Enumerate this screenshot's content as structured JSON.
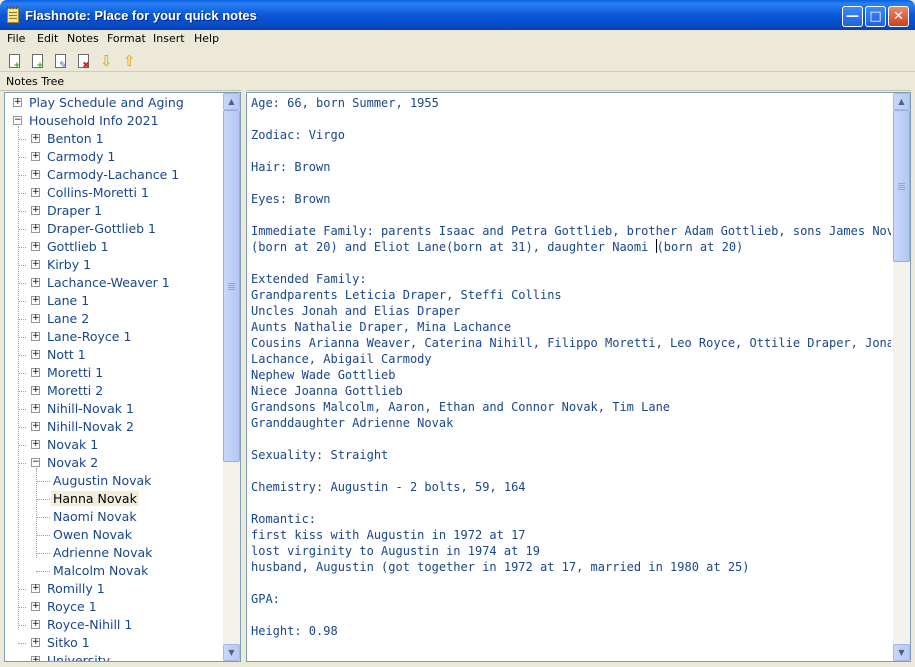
{
  "window": {
    "title": "Flashnote: Place for your quick notes"
  },
  "menu": [
    "File",
    "Edit",
    "Notes",
    "Format",
    "Insert",
    "Help"
  ],
  "toolbar": [
    {
      "icon": "add-note-icon",
      "color": "#1BA81B"
    },
    {
      "icon": "add-subnote-icon",
      "color": "#1BA81B"
    },
    {
      "icon": "edit-note-icon",
      "color": "#3060C0"
    },
    {
      "icon": "delete-note-icon",
      "color": "#D02020"
    },
    {
      "icon": "move-down-icon",
      "color": "#E8A000"
    },
    {
      "icon": "move-up-icon",
      "color": "#E8A000"
    }
  ],
  "tree_header": "Notes Tree",
  "tree": [
    {
      "label": "Play Schedule and Aging",
      "level": 0,
      "expander": "+"
    },
    {
      "label": "Household Info 2021",
      "level": 0,
      "expander": "-"
    },
    {
      "label": "Benton 1",
      "level": 1,
      "expander": "+"
    },
    {
      "label": "Carmody 1",
      "level": 1,
      "expander": "+"
    },
    {
      "label": "Carmody-Lachance 1",
      "level": 1,
      "expander": "+"
    },
    {
      "label": "Collins-Moretti 1",
      "level": 1,
      "expander": "+"
    },
    {
      "label": "Draper 1",
      "level": 1,
      "expander": "+"
    },
    {
      "label": "Draper-Gottlieb 1",
      "level": 1,
      "expander": "+"
    },
    {
      "label": "Gottlieb 1",
      "level": 1,
      "expander": "+"
    },
    {
      "label": "Kirby 1",
      "level": 1,
      "expander": "+"
    },
    {
      "label": "Lachance-Weaver 1",
      "level": 1,
      "expander": "+"
    },
    {
      "label": "Lane 1",
      "level": 1,
      "expander": "+"
    },
    {
      "label": "Lane 2",
      "level": 1,
      "expander": "+"
    },
    {
      "label": "Lane-Royce 1",
      "level": 1,
      "expander": "+"
    },
    {
      "label": "Nott 1",
      "level": 1,
      "expander": "+"
    },
    {
      "label": "Moretti 1",
      "level": 1,
      "expander": "+"
    },
    {
      "label": "Moretti 2",
      "level": 1,
      "expander": "+"
    },
    {
      "label": "Nihill-Novak 1",
      "level": 1,
      "expander": "+"
    },
    {
      "label": "Nihill-Novak 2",
      "level": 1,
      "expander": "+"
    },
    {
      "label": "Novak 1",
      "level": 1,
      "expander": "+"
    },
    {
      "label": "Novak 2",
      "level": 1,
      "expander": "-"
    },
    {
      "label": "Augustin Novak",
      "level": 2,
      "expander": ""
    },
    {
      "label": "Hanna Novak",
      "level": 2,
      "expander": "",
      "selected": true
    },
    {
      "label": "Naomi Novak",
      "level": 2,
      "expander": ""
    },
    {
      "label": "Owen Novak",
      "level": 2,
      "expander": ""
    },
    {
      "label": "Adrienne Novak",
      "level": 2,
      "expander": ""
    },
    {
      "label": "Malcolm Novak",
      "level": 2,
      "expander": ""
    },
    {
      "label": "Romilly 1",
      "level": 1,
      "expander": "+"
    },
    {
      "label": "Royce 1",
      "level": 1,
      "expander": "+"
    },
    {
      "label": "Royce-Nihill 1",
      "level": 1,
      "expander": "+"
    },
    {
      "label": "Sitko 1",
      "level": 1,
      "expander": "+"
    },
    {
      "label": "University",
      "level": 1,
      "expander": "+"
    }
  ],
  "note_lines": [
    "Age: 66, born Summer, 1955",
    "",
    "Zodiac: Virgo",
    "",
    "Hair: Brown",
    "",
    "Eyes: Brown",
    "",
    "Immediate Family: parents Isaac and Petra Gottlieb, brother Adam Gottlieb, sons James Novak",
    "(born at 20) and Eliot Lane(born at 31), daughter Naomi (born at 20)",
    "",
    "Extended Family:",
    "Grandparents Leticia Draper, Steffi Collins",
    "Uncles Jonah and Elias Draper",
    "Aunts Nathalie Draper, Mina Lachance",
    "Cousins Arianna Weaver, Caterina Nihill, Filippo Moretti, Leo Royce, Ottilie Draper, Jonas",
    "Lachance, Abigail Carmody",
    "Nephew Wade Gottlieb",
    "Niece Joanna Gottlieb",
    "Grandsons Malcolm, Aaron, Ethan and Connor Novak, Tim Lane",
    "Granddaughter Adrienne Novak",
    "",
    "Sexuality: Straight",
    "",
    "Chemistry: Augustin - 2 bolts, 59, 164",
    "",
    "Romantic:",
    "first kiss with Augustin in 1972 at 17",
    "lost virginity to Augustin in 1974 at 19",
    "husband, Augustin (got together in 1972 at 17, married in 1980 at 25)",
    "",
    "GPA:",
    "",
    "Height: 0.98"
  ],
  "colors": {
    "titlebar": "#0A58D6",
    "tree_text": "#19468C",
    "note_text": "#19468C",
    "selection": "#F1EEDC"
  }
}
